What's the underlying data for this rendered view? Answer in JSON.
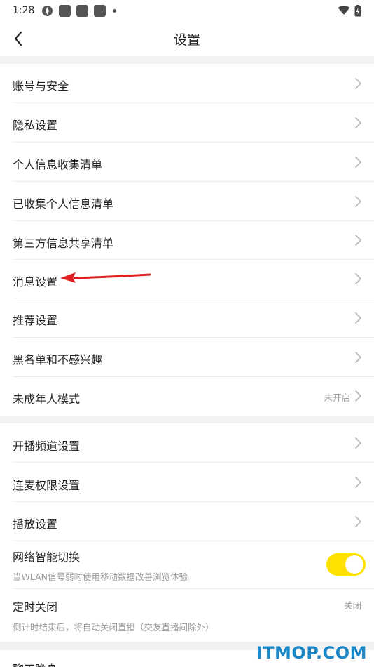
{
  "status_bar": {
    "time": "1:28"
  },
  "nav": {
    "title": "设置"
  },
  "group1": [
    {
      "label": "账号与安全"
    },
    {
      "label": "隐私设置"
    },
    {
      "label": "个人信息收集清单"
    },
    {
      "label": "已收集个人信息清单"
    },
    {
      "label": "第三方信息共享清单"
    },
    {
      "label": "消息设置"
    },
    {
      "label": "推荐设置"
    },
    {
      "label": "黑名单和不感兴趣"
    },
    {
      "label": "未成年人模式",
      "value": "未开启"
    }
  ],
  "group2": {
    "items": [
      {
        "label": "开播频道设置"
      },
      {
        "label": "连麦权限设置"
      },
      {
        "label": "播放设置"
      }
    ],
    "network_switch": {
      "label": "网络智能切换",
      "sub": "当WLAN信号弱时使用移动数据改善浏览体验",
      "on": true
    },
    "timer": {
      "label": "定时关闭",
      "sub": "倒计时结束后，将自动关闭直播（交友直播间除外）",
      "value": "关闭"
    }
  },
  "group3": {
    "partial_label": "聊天隐身"
  },
  "watermark": {
    "text": "ITMOP.COM"
  },
  "colors": {
    "toggle_on": "#ffe100",
    "annotation_arrow": "#e02020",
    "section_gap": "#f2f2f5"
  },
  "icons": [
    "back-arrow-icon",
    "chevron-right-icon",
    "wifi-icon",
    "battery-icon"
  ]
}
